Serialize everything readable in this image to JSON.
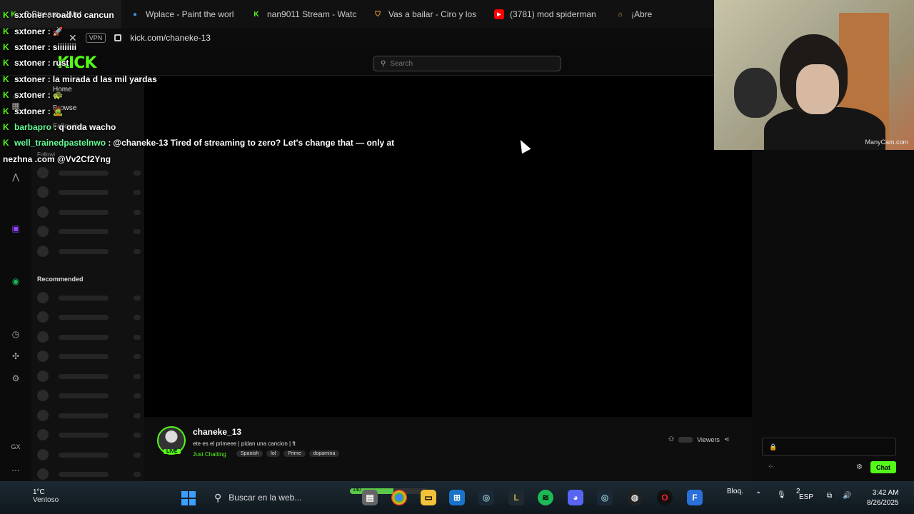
{
  "browser": {
    "tabs": [
      {
        "label": "3 Stream - Wat",
        "icon": "kick-icon",
        "color": "#53fc18"
      },
      {
        "label": "Wplace - Paint the worl",
        "icon": "globe-icon",
        "color": "#3a8fe0"
      },
      {
        "label": "nan9011 Stream - Watc",
        "icon": "kick-icon",
        "color": "#53fc18"
      },
      {
        "label": "Vas a bailar - Ciro y los",
        "icon": "shield-icon",
        "color": "#f0a030"
      },
      {
        "label": "(3781) mod spiderman",
        "icon": "youtube-icon",
        "color": "#ff0000"
      },
      {
        "label": "¡Abre",
        "icon": "gift-icon",
        "color": "#e0b050"
      }
    ],
    "vpn_label": "VPN",
    "url": "kick.com/chaneke-13"
  },
  "kick": {
    "logo": "KICK",
    "search_placeholder": "Search",
    "nav": [
      {
        "label": "Home",
        "icon": "home-icon"
      },
      {
        "label": "Browse",
        "icon": "browse-icon"
      },
      {
        "label": "Following",
        "icon": "heart-icon"
      }
    ],
    "following_label": "Followi",
    "recommended_label": "Recommended",
    "accent": "#53fc18"
  },
  "chat_overlay": [
    {
      "user": "sxtoner",
      "text": "road to cancun"
    },
    {
      "user": "sxtoner",
      "text": "🚀"
    },
    {
      "user": "sxtoner",
      "text": "siiiiiiii"
    },
    {
      "user": "sxtoner",
      "text": "rust"
    },
    {
      "user": "sxtoner",
      "text": "la mirada d las mil yardas"
    },
    {
      "user": "sxtoner",
      "text": "🐢"
    },
    {
      "user": "sxtoner",
      "text": "🧟"
    },
    {
      "user": "barbapro",
      "text": "q onda wacho"
    },
    {
      "user": "well_trainedpastelnwo",
      "text": "@chaneke-13 Tired of streaming to zero? Let's change that — only at"
    }
  ],
  "chat_overlay_cont": "nezhna .com @Vv2Cf2Yng",
  "stream": {
    "channel": "chaneke_13",
    "live_label": "LIVE",
    "title": "ete es el primeee | pidan una cancion | ft",
    "category": "Just Chatting",
    "tags": [
      "Spanish",
      "lol",
      "Prime",
      "dopamina"
    ],
    "viewers_label": "Viewers"
  },
  "chat_panel": {
    "chat_button": "Chat"
  },
  "webcam": {
    "watermark": "ManyCam.com"
  },
  "taskbar": {
    "temp": "1°C",
    "condition": "Ventoso",
    "search_placeholder": "Buscar en la web...",
    "progress_label": "140",
    "progress": 0.55,
    "tray": {
      "caps": "Bloq.",
      "notif_count": "2",
      "lang": "ESP"
    },
    "time": "3:42 AM",
    "date": "8/26/2025"
  }
}
